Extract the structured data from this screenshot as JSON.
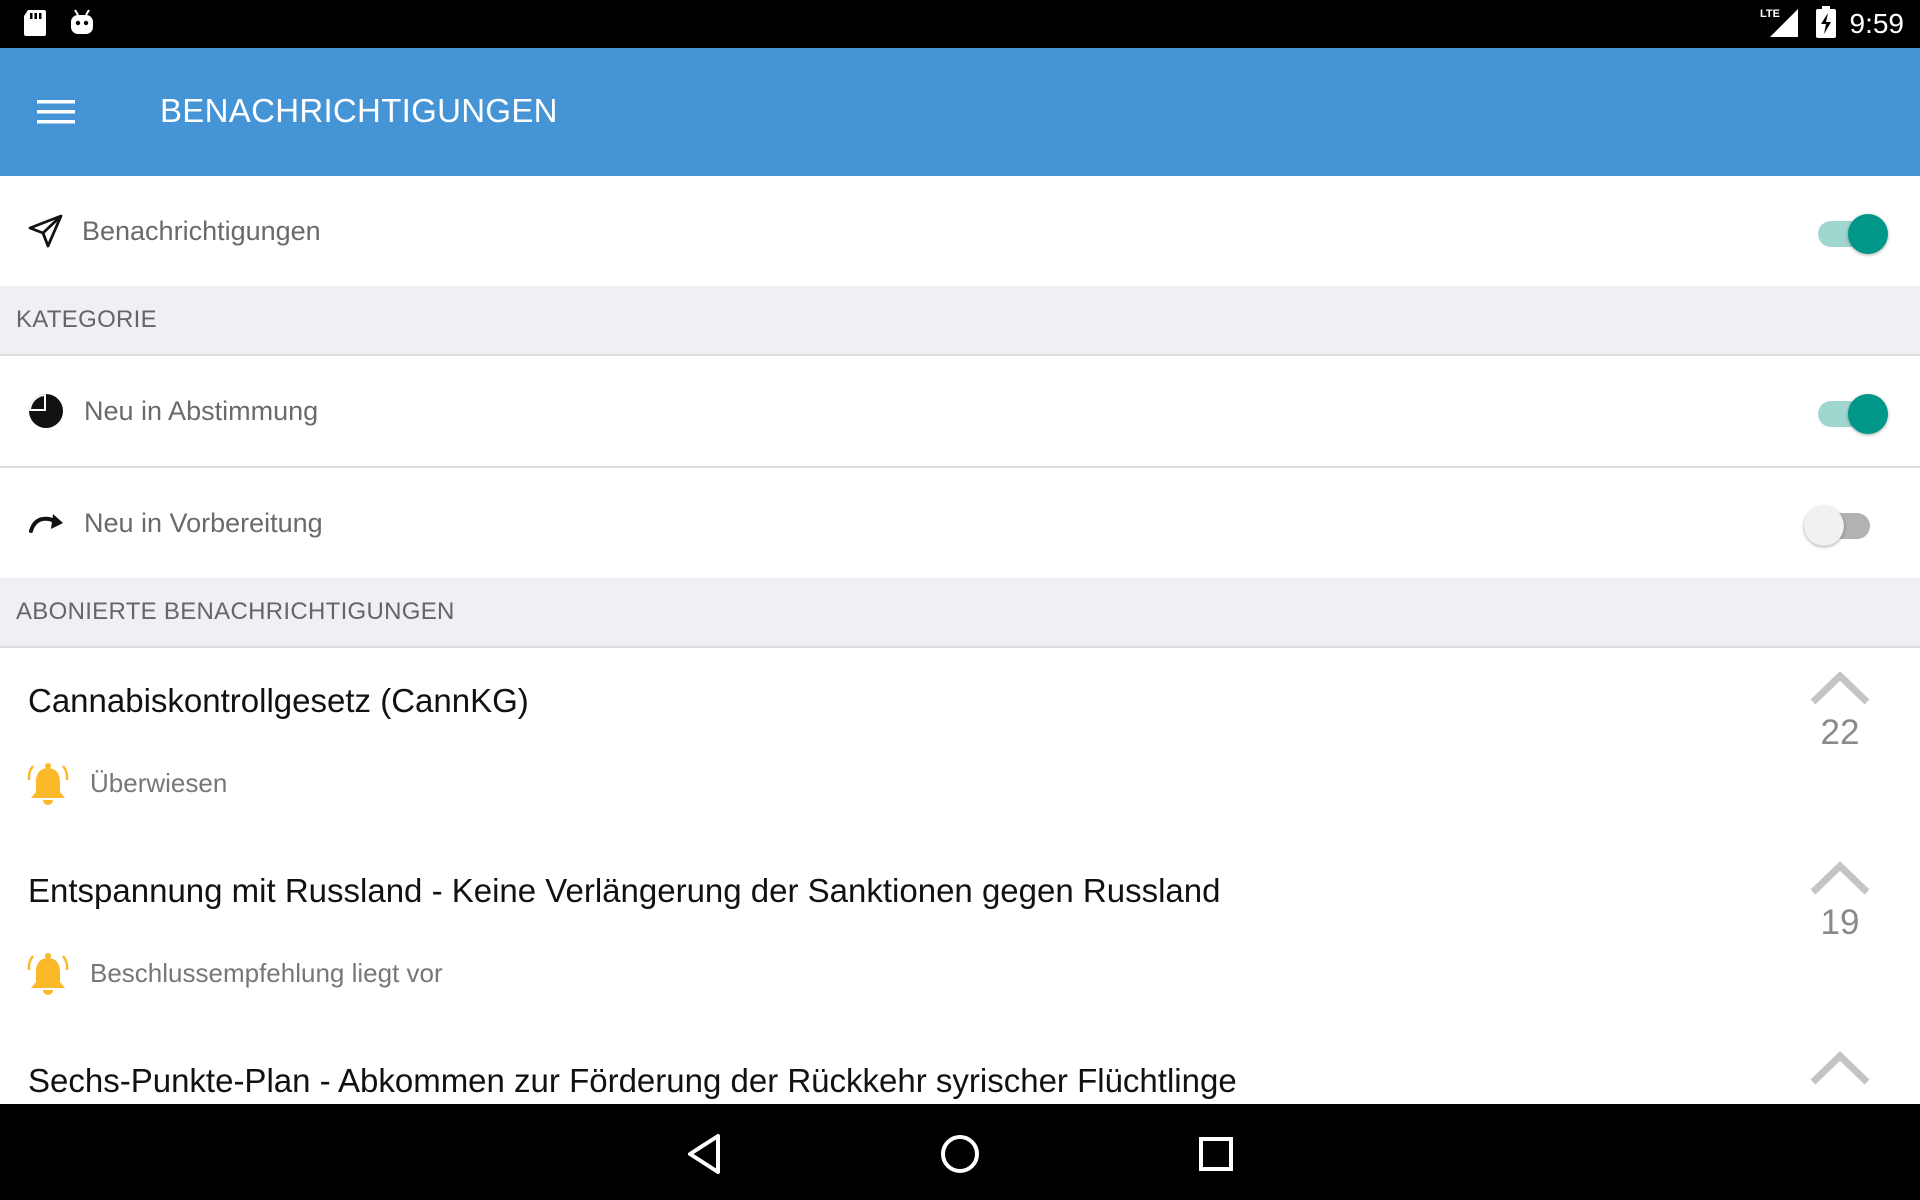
{
  "status_bar": {
    "time": "9:59",
    "network": "LTE",
    "icons": [
      "sd-card-icon",
      "android-icon",
      "lte-signal-icon",
      "battery-charging-icon"
    ]
  },
  "app_bar": {
    "title": "BENACHRICHTIGUNGEN",
    "menu_icon": "hamburger-menu-icon",
    "background": "#4594d5"
  },
  "master_toggle": {
    "label": "Benachrichtigungen",
    "icon": "paper-plane-icon",
    "enabled": true
  },
  "kategorie": {
    "header": "KATEGORIE",
    "items": [
      {
        "label": "Neu in Abstimmung",
        "icon": "pie-chart-icon",
        "enabled": true
      },
      {
        "label": "Neu in Vorbereitung",
        "icon": "redo-arrow-icon",
        "enabled": false
      }
    ]
  },
  "abonniert": {
    "header": "ABONIERTE BENACHRICHTIGUNGEN",
    "items": [
      {
        "title": "Cannabiskontrollgesetz (CannKG)",
        "status": "Überwiesen",
        "votes": "22"
      },
      {
        "title": "Entspannung mit Russland - Keine Verlängerung der Sanktionen gegen Russland",
        "status": "Beschlussempfehlung liegt vor",
        "votes": "19"
      },
      {
        "title": "Sechs-Punkte-Plan - Abkommen zur Förderung der Rückkehr syrischer Flüchtlinge",
        "status": "",
        "votes": ""
      }
    ]
  },
  "colors": {
    "accent": "#009688",
    "bell": "#fbb829",
    "section_bg": "#efeff4"
  },
  "nav_bar": {
    "icons": [
      "back-icon",
      "home-icon",
      "recents-icon"
    ]
  }
}
